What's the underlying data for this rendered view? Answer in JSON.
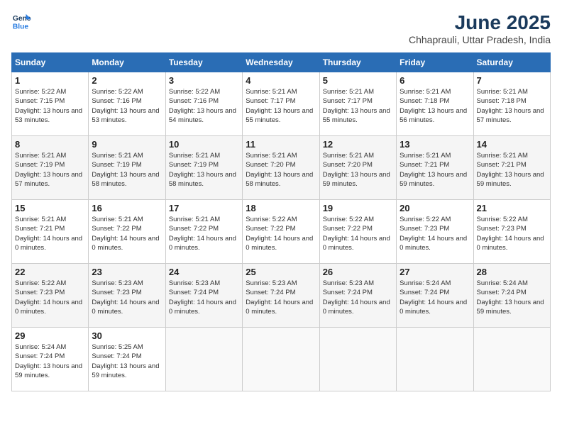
{
  "logo": {
    "line1": "General",
    "line2": "Blue"
  },
  "title": "June 2025",
  "location": "Chhaprauli, Uttar Pradesh, India",
  "headers": [
    "Sunday",
    "Monday",
    "Tuesday",
    "Wednesday",
    "Thursday",
    "Friday",
    "Saturday"
  ],
  "weeks": [
    [
      {
        "day": "1",
        "sunrise": "5:22 AM",
        "sunset": "7:15 PM",
        "daylight": "13 hours and 53 minutes."
      },
      {
        "day": "2",
        "sunrise": "5:22 AM",
        "sunset": "7:16 PM",
        "daylight": "13 hours and 53 minutes."
      },
      {
        "day": "3",
        "sunrise": "5:22 AM",
        "sunset": "7:16 PM",
        "daylight": "13 hours and 54 minutes."
      },
      {
        "day": "4",
        "sunrise": "5:21 AM",
        "sunset": "7:17 PM",
        "daylight": "13 hours and 55 minutes."
      },
      {
        "day": "5",
        "sunrise": "5:21 AM",
        "sunset": "7:17 PM",
        "daylight": "13 hours and 55 minutes."
      },
      {
        "day": "6",
        "sunrise": "5:21 AM",
        "sunset": "7:18 PM",
        "daylight": "13 hours and 56 minutes."
      },
      {
        "day": "7",
        "sunrise": "5:21 AM",
        "sunset": "7:18 PM",
        "daylight": "13 hours and 57 minutes."
      }
    ],
    [
      {
        "day": "8",
        "sunrise": "5:21 AM",
        "sunset": "7:19 PM",
        "daylight": "13 hours and 57 minutes."
      },
      {
        "day": "9",
        "sunrise": "5:21 AM",
        "sunset": "7:19 PM",
        "daylight": "13 hours and 58 minutes."
      },
      {
        "day": "10",
        "sunrise": "5:21 AM",
        "sunset": "7:19 PM",
        "daylight": "13 hours and 58 minutes."
      },
      {
        "day": "11",
        "sunrise": "5:21 AM",
        "sunset": "7:20 PM",
        "daylight": "13 hours and 58 minutes."
      },
      {
        "day": "12",
        "sunrise": "5:21 AM",
        "sunset": "7:20 PM",
        "daylight": "13 hours and 59 minutes."
      },
      {
        "day": "13",
        "sunrise": "5:21 AM",
        "sunset": "7:21 PM",
        "daylight": "13 hours and 59 minutes."
      },
      {
        "day": "14",
        "sunrise": "5:21 AM",
        "sunset": "7:21 PM",
        "daylight": "13 hours and 59 minutes."
      }
    ],
    [
      {
        "day": "15",
        "sunrise": "5:21 AM",
        "sunset": "7:21 PM",
        "daylight": "14 hours and 0 minutes."
      },
      {
        "day": "16",
        "sunrise": "5:21 AM",
        "sunset": "7:22 PM",
        "daylight": "14 hours and 0 minutes."
      },
      {
        "day": "17",
        "sunrise": "5:21 AM",
        "sunset": "7:22 PM",
        "daylight": "14 hours and 0 minutes."
      },
      {
        "day": "18",
        "sunrise": "5:22 AM",
        "sunset": "7:22 PM",
        "daylight": "14 hours and 0 minutes."
      },
      {
        "day": "19",
        "sunrise": "5:22 AM",
        "sunset": "7:22 PM",
        "daylight": "14 hours and 0 minutes."
      },
      {
        "day": "20",
        "sunrise": "5:22 AM",
        "sunset": "7:23 PM",
        "daylight": "14 hours and 0 minutes."
      },
      {
        "day": "21",
        "sunrise": "5:22 AM",
        "sunset": "7:23 PM",
        "daylight": "14 hours and 0 minutes."
      }
    ],
    [
      {
        "day": "22",
        "sunrise": "5:22 AM",
        "sunset": "7:23 PM",
        "daylight": "14 hours and 0 minutes."
      },
      {
        "day": "23",
        "sunrise": "5:23 AM",
        "sunset": "7:23 PM",
        "daylight": "14 hours and 0 minutes."
      },
      {
        "day": "24",
        "sunrise": "5:23 AM",
        "sunset": "7:24 PM",
        "daylight": "14 hours and 0 minutes."
      },
      {
        "day": "25",
        "sunrise": "5:23 AM",
        "sunset": "7:24 PM",
        "daylight": "14 hours and 0 minutes."
      },
      {
        "day": "26",
        "sunrise": "5:23 AM",
        "sunset": "7:24 PM",
        "daylight": "14 hours and 0 minutes."
      },
      {
        "day": "27",
        "sunrise": "5:24 AM",
        "sunset": "7:24 PM",
        "daylight": "14 hours and 0 minutes."
      },
      {
        "day": "28",
        "sunrise": "5:24 AM",
        "sunset": "7:24 PM",
        "daylight": "13 hours and 59 minutes."
      }
    ],
    [
      {
        "day": "29",
        "sunrise": "5:24 AM",
        "sunset": "7:24 PM",
        "daylight": "13 hours and 59 minutes."
      },
      {
        "day": "30",
        "sunrise": "5:25 AM",
        "sunset": "7:24 PM",
        "daylight": "13 hours and 59 minutes."
      },
      null,
      null,
      null,
      null,
      null
    ]
  ]
}
